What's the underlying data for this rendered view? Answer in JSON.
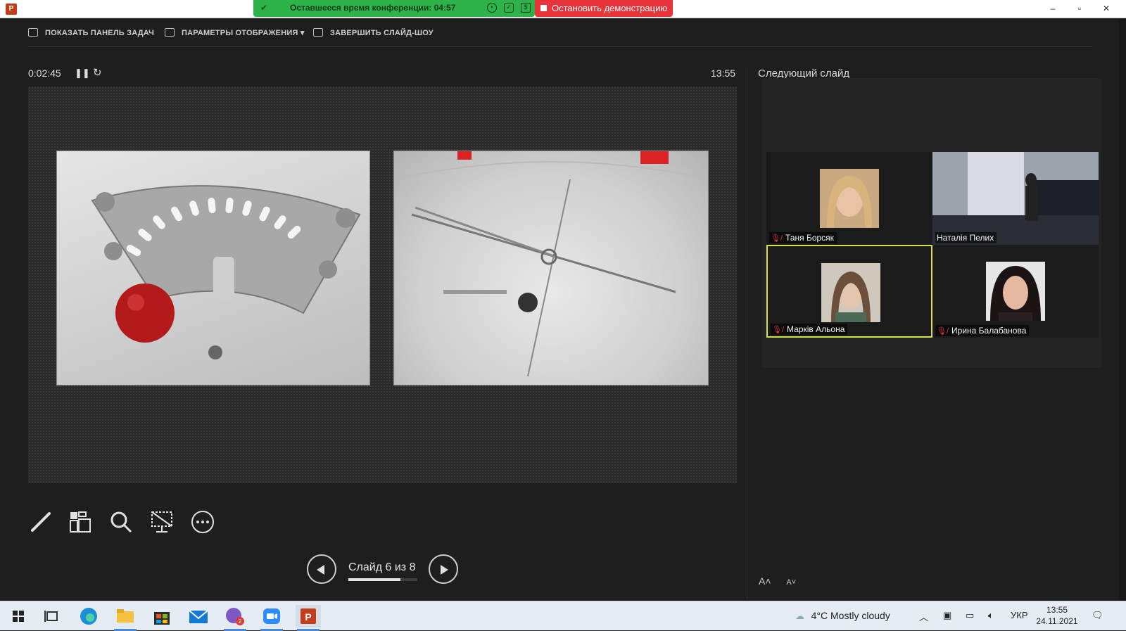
{
  "titlebar": {
    "conference_timer": "Оставшееся время конференции: 04:57",
    "stop_demo": "Остановить демонстрацию",
    "minimize": "–",
    "maximize": "▫",
    "close": "✕"
  },
  "toolbar": {
    "show_taskbar": "ПОКАЗАТЬ ПАНЕЛЬ ЗАДАЧ",
    "display_settings": "ПАРАМЕТРЫ ОТОБРАЖЕНИЯ ▾",
    "end_slideshow": "ЗАВЕРШИТЬ СЛАЙД-ШОУ"
  },
  "presenter": {
    "elapsed": "0:02:45",
    "clock": "13:55",
    "next_slide_label": "Следующий слайд",
    "slide_counter": "Слайд 6 из 8",
    "progress": 0.75
  },
  "participants": [
    {
      "name": "Таня Борсяк",
      "muted": true
    },
    {
      "name": "Наталія Пелих",
      "muted": false
    },
    {
      "name": "Марків Альона",
      "muted": true,
      "active": true
    },
    {
      "name": "Ирина Балабанова",
      "muted": true
    }
  ],
  "taskbar": {
    "weather": "4°C  Mostly cloudy",
    "lang": "УКР",
    "time": "13:55",
    "date": "24.11.2021",
    "viber_badge": "2"
  },
  "colors": {
    "conference_bar": "#2db34a",
    "stop_button": "#e8333b",
    "active_speaker": "#d5e14b",
    "muted_mic": "#e0353b"
  }
}
